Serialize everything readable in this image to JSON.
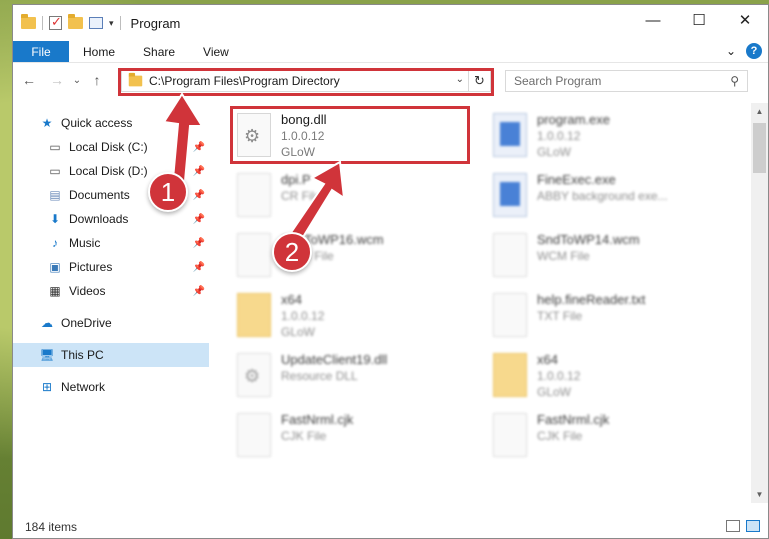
{
  "window": {
    "title": "Program",
    "controls": {
      "minimize": "—",
      "maximize": "☐",
      "close": "✕"
    }
  },
  "ribbon": {
    "tabs": [
      "File",
      "Home",
      "Share",
      "View"
    ],
    "expand": "⌄",
    "help": "?"
  },
  "address_bar": {
    "path": "C:\\Program Files\\Program Directory",
    "refresh": "↻",
    "dropdown": "⌄"
  },
  "search": {
    "placeholder": "Search Program"
  },
  "navigation": {
    "back": "←",
    "forward": "→",
    "recent": "⌄",
    "up": "↑",
    "items": [
      {
        "label": "Quick access",
        "icon": "star-icon"
      },
      {
        "label": "Local Disk (C:)",
        "icon": "drive-icon",
        "pinned": true
      },
      {
        "label": "Local Disk (D:)",
        "icon": "drive-icon",
        "pinned": true
      },
      {
        "label": "Documents",
        "icon": "documents-icon",
        "pinned": true
      },
      {
        "label": "Downloads",
        "icon": "downloads-icon",
        "pinned": true
      },
      {
        "label": "Music",
        "icon": "music-icon",
        "pinned": true
      },
      {
        "label": "Pictures",
        "icon": "pictures-icon",
        "pinned": true
      },
      {
        "label": "Videos",
        "icon": "videos-icon",
        "pinned": true
      },
      {
        "label": "OneDrive",
        "icon": "onedrive-icon"
      },
      {
        "label": "This PC",
        "icon": "pc-icon",
        "selected": true
      },
      {
        "label": "Network",
        "icon": "network-icon"
      }
    ]
  },
  "files": [
    {
      "name": "bong.dll",
      "line2": "1.0.0.12",
      "line3": "GLoW"
    },
    {
      "name": "program.exe",
      "line2": "1.0.0.12",
      "line3": "GLoW"
    },
    {
      "name": "dpi.P",
      "line2": "CR File",
      "line3": ""
    },
    {
      "name": "FineExec.exe",
      "line2": "ABBY background exe...",
      "line3": ""
    },
    {
      "name": "SndToWP16.wcm",
      "line2": "WCM File",
      "line3": ""
    },
    {
      "name": "SndToWP14.wcm",
      "line2": "WCM File",
      "line3": ""
    },
    {
      "name": "x64",
      "line2": "1.0.0.12",
      "line3": "GLoW"
    },
    {
      "name": "help.fineReader.txt",
      "line2": "TXT File",
      "line3": ""
    },
    {
      "name": "UpdateClient19.dll",
      "line2": "Resource DLL",
      "line3": ""
    },
    {
      "name": "x64",
      "line2": "1.0.0.12",
      "line3": "GLoW"
    },
    {
      "name": "FastNrml.cjk",
      "line2": "CJK File",
      "line3": ""
    },
    {
      "name": "FastNrml.cjk",
      "line2": "CJK File",
      "line3": ""
    }
  ],
  "status": {
    "items": "184 items"
  },
  "annotations": {
    "step1": "1",
    "step2": "2"
  },
  "colors": {
    "accent": "#1979ca",
    "highlight": "#d0343a",
    "selected": "#cce4f7"
  }
}
